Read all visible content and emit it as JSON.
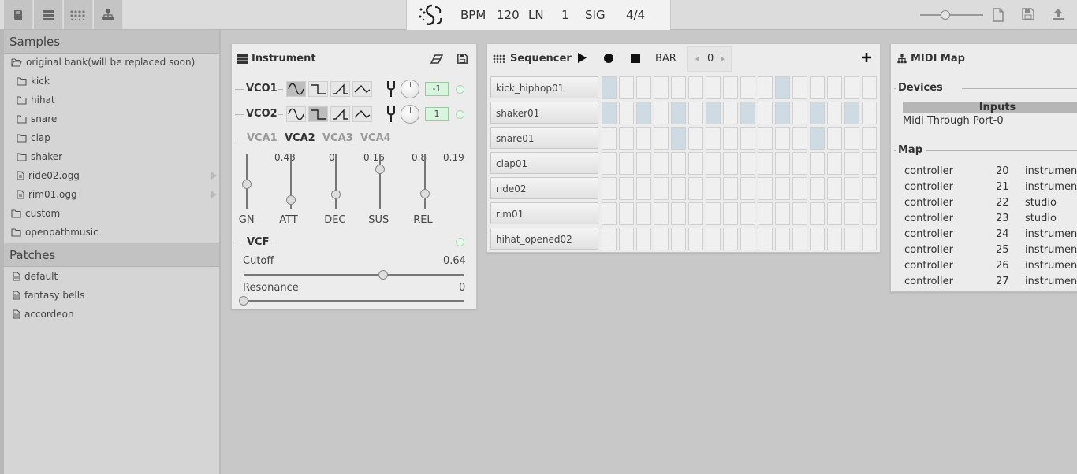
{
  "toolbar": {
    "left_buttons": [
      {
        "icon": "book-icon"
      },
      {
        "icon": "list-icon"
      },
      {
        "icon": "grid-dots-icon"
      },
      {
        "icon": "hierarchy-icon"
      }
    ],
    "bpm_label": "BPM",
    "bpm_value": "120",
    "ln_label": "LN",
    "ln_value": "1",
    "sig_label": "SIG",
    "sig_value": "4/4",
    "zoom_level": 0.4,
    "right_icons": [
      "new-file-icon",
      "save-icon",
      "upload-icon"
    ]
  },
  "sidebar": {
    "samples_title": "Samples",
    "samples": [
      {
        "label": "original bank(will be replaced soon)",
        "icon": "folder-open-icon",
        "indent": 0
      },
      {
        "label": "kick",
        "icon": "folder-icon",
        "indent": 1
      },
      {
        "label": "hihat",
        "icon": "folder-icon",
        "indent": 1
      },
      {
        "label": "snare",
        "icon": "folder-icon",
        "indent": 1
      },
      {
        "label": "clap",
        "icon": "folder-icon",
        "indent": 1
      },
      {
        "label": "shaker",
        "icon": "folder-icon",
        "indent": 1
      },
      {
        "label": "ride02.ogg",
        "icon": "file-icon",
        "indent": 1,
        "arrow": true
      },
      {
        "label": "rim01.ogg",
        "icon": "file-icon",
        "indent": 1,
        "arrow": true
      },
      {
        "label": "custom",
        "icon": "folder-icon",
        "indent": 0
      },
      {
        "label": "openpathmusic",
        "icon": "folder-icon",
        "indent": 0
      }
    ],
    "patches_title": "Patches",
    "patches": [
      {
        "label": "default",
        "icon": "patch-file-icon"
      },
      {
        "label": "fantasy bells",
        "icon": "patch-file-icon"
      },
      {
        "label": "accordeon",
        "icon": "patch-file-icon"
      }
    ]
  },
  "instrument": {
    "title": "Instrument",
    "vco1": {
      "label": "VCO1",
      "value": "-1",
      "active_wave": 0
    },
    "vco2": {
      "label": "VCO2",
      "value": "1",
      "active_wave": 1
    },
    "vca_tabs": [
      "VCA1",
      "VCA2",
      "VCA3",
      "VCA4"
    ],
    "vca_active": 1,
    "envelope": [
      {
        "label": "GN",
        "value": "",
        "level": 0.45
      },
      {
        "label": "ATT",
        "value": "0.43",
        "level": 0.1
      },
      {
        "label": "DEC",
        "value": "0",
        "level": 0.22
      },
      {
        "label": "SUS",
        "value": "0.16",
        "level": 0.77
      },
      {
        "label": "REL",
        "value": "0.8",
        "level": 0.25
      },
      {
        "label": "",
        "value": "0.19",
        "level": null
      }
    ],
    "vcf_label": "VCF",
    "cutoff_label": "Cutoff",
    "cutoff_value": "0.64",
    "cutoff_level": 0.64,
    "resonance_label": "Resonance",
    "resonance_value": "0",
    "resonance_level": 0
  },
  "sequencer": {
    "title": "Sequencer",
    "bar_label": "BAR",
    "bar_value": "0",
    "tracks": [
      {
        "name": "kick_hiphop01",
        "steps": [
          1,
          0,
          0,
          0,
          0,
          0,
          0,
          0,
          0,
          0,
          1,
          0,
          0,
          0,
          0,
          0
        ]
      },
      {
        "name": "shaker01",
        "steps": [
          1,
          0,
          1,
          0,
          1,
          0,
          1,
          0,
          1,
          0,
          1,
          0,
          1,
          0,
          1,
          0
        ]
      },
      {
        "name": "snare01",
        "steps": [
          0,
          0,
          0,
          0,
          1,
          0,
          0,
          0,
          0,
          0,
          0,
          0,
          1,
          0,
          0,
          0
        ]
      },
      {
        "name": "clap01",
        "steps": [
          0,
          0,
          0,
          0,
          0,
          0,
          0,
          0,
          0,
          0,
          0,
          0,
          0,
          0,
          0,
          0
        ]
      },
      {
        "name": "ride02",
        "steps": [
          0,
          0,
          0,
          0,
          0,
          0,
          0,
          0,
          0,
          0,
          0,
          0,
          0,
          0,
          0,
          0
        ]
      },
      {
        "name": "rim01",
        "steps": [
          0,
          0,
          0,
          0,
          0,
          0,
          0,
          0,
          0,
          0,
          0,
          0,
          0,
          0,
          0,
          0
        ]
      },
      {
        "name": "hihat_opened02",
        "steps": [
          0,
          0,
          0,
          0,
          0,
          0,
          0,
          0,
          0,
          0,
          0,
          0,
          0,
          0,
          0,
          0
        ]
      }
    ]
  },
  "midi": {
    "title": "MIDI Map",
    "devices_label": "Devices",
    "inputs_header": "Inputs",
    "input_device": "Midi Through Port-0",
    "map_label": "Map",
    "map_rows": [
      {
        "type": "controller",
        "num": "20",
        "target": "instrument"
      },
      {
        "type": "controller",
        "num": "21",
        "target": "instrument"
      },
      {
        "type": "controller",
        "num": "22",
        "target": "studio"
      },
      {
        "type": "controller",
        "num": "23",
        "target": "studio"
      },
      {
        "type": "controller",
        "num": "24",
        "target": "instrument"
      },
      {
        "type": "controller",
        "num": "25",
        "target": "instrument"
      },
      {
        "type": "controller",
        "num": "26",
        "target": "instrument"
      },
      {
        "type": "controller",
        "num": "27",
        "target": "instrument"
      }
    ]
  }
}
